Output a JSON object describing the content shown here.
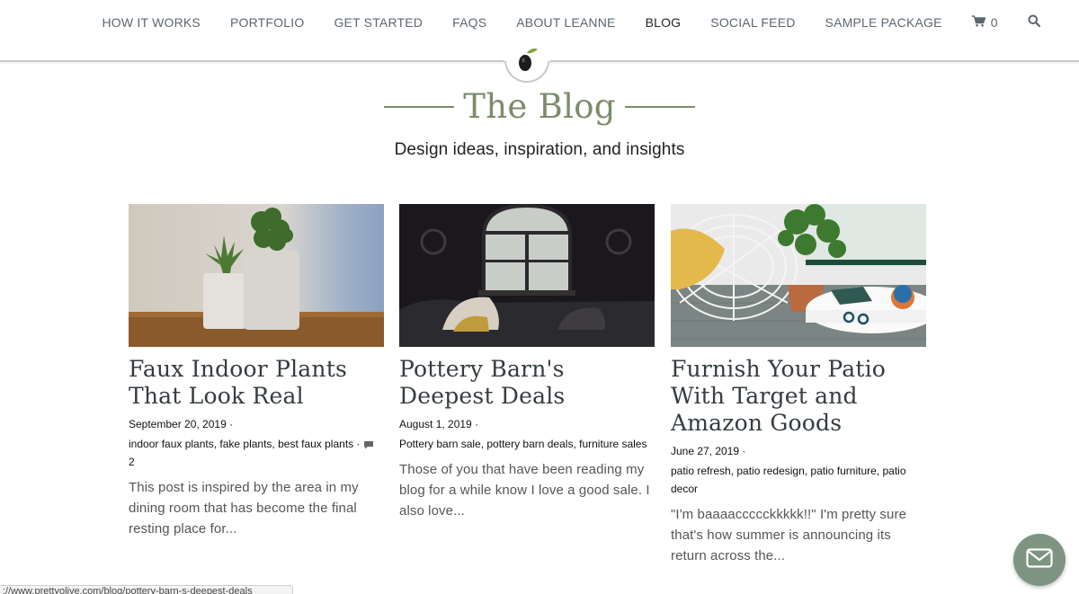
{
  "nav": {
    "items": [
      "HOW IT WORKS",
      "PORTFOLIO",
      "GET STARTED",
      "FAQS",
      "ABOUT LEANNE",
      "BLOG",
      "SOCIAL FEED",
      "SAMPLE PACKAGE"
    ],
    "active": "BLOG",
    "cart_count": "0"
  },
  "page": {
    "title": "The Blog",
    "subtitle": "Design ideas, inspiration, and insights"
  },
  "posts": [
    {
      "title": "Faux Indoor Plants That Look Real",
      "date": "September 20, 2019 ·",
      "tags": "indoor faux plants, fake plants, best faux plants ·",
      "comments": "2",
      "excerpt": "This post is inspired by the area in my dining room that has become the final resting place for..."
    },
    {
      "title": "Pottery Barn's Deepest Deals",
      "date": "August 1, 2019 ·",
      "tags": "Pottery barn sale, pottery barn deals, furniture sales",
      "excerpt": "Those of you that have been reading my blog for a while know I love a good sale. I also love..."
    },
    {
      "title": "Furnish Your Patio With Target and Amazon Goods",
      "date": "June 27, 2019 ·",
      "tags": "patio refresh, patio redesign, patio furniture, patio decor",
      "excerpt": "\"I'm baaaaccccckkkkk!!\" I'm pretty sure that's how summer is announcing its return across the..."
    }
  ],
  "status": {
    "url": "://www.prettyolive.com/blog/pottery-barn-s-deepest-deals"
  },
  "colors": {
    "accent": "#7d8b6a",
    "chat_button": "#7d9480",
    "nav_text": "#5b6770"
  }
}
